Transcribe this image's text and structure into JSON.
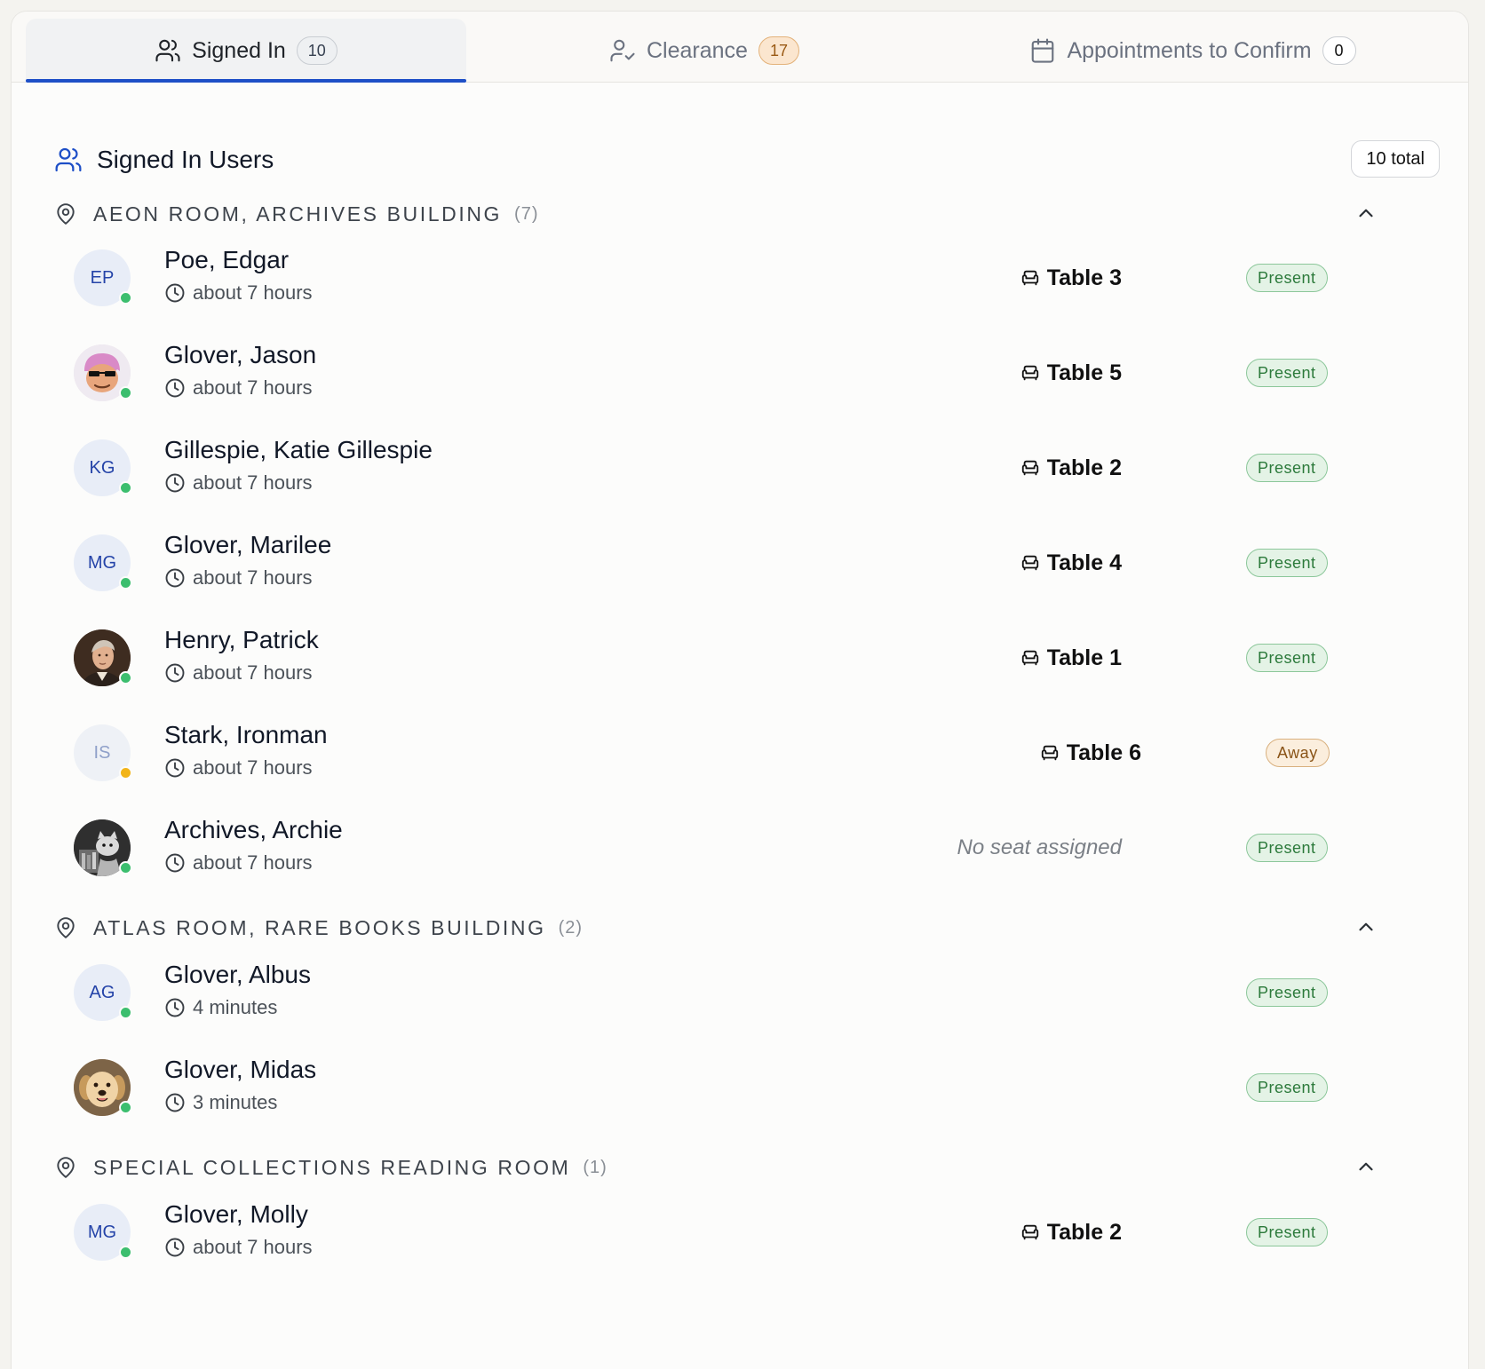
{
  "tabs": [
    {
      "label": "Signed In",
      "count": "10"
    },
    {
      "label": "Clearance",
      "count": "17"
    },
    {
      "label": "Appointments to Confirm",
      "count": "0"
    }
  ],
  "header": {
    "title": "Signed In Users",
    "total": "10 total"
  },
  "groups": [
    {
      "name": "AEON ROOM, ARCHIVES BUILDING",
      "count": "(7)",
      "users": [
        {
          "initials": "EP",
          "name": "Poe, Edgar",
          "since": "about 7 hours",
          "seat": "Table 3",
          "status": "Present"
        },
        {
          "initials": "",
          "name": "Glover, Jason",
          "since": "about 7 hours",
          "seat": "Table 5",
          "status": "Present"
        },
        {
          "initials": "KG",
          "name": "Gillespie, Katie Gillespie",
          "since": "about 7 hours",
          "seat": "Table 2",
          "status": "Present"
        },
        {
          "initials": "MG",
          "name": "Glover, Marilee",
          "since": "about 7 hours",
          "seat": "Table 4",
          "status": "Present"
        },
        {
          "initials": "",
          "name": "Henry, Patrick",
          "since": "about 7 hours",
          "seat": "Table 1",
          "status": "Present"
        },
        {
          "initials": "IS",
          "name": "Stark, Ironman",
          "since": "about 7 hours",
          "seat": "Table 6",
          "status": "Away"
        },
        {
          "initials": "",
          "name": "Archives, Archie",
          "since": "about 7 hours",
          "seat": "No seat assigned",
          "status": "Present"
        }
      ]
    },
    {
      "name": "ATLAS ROOM, RARE BOOKS BUILDING",
      "count": "(2)",
      "users": [
        {
          "initials": "AG",
          "name": "Glover, Albus",
          "since": "4 minutes",
          "seat": "",
          "status": "Present"
        },
        {
          "initials": "",
          "name": "Glover, Midas",
          "since": "3 minutes",
          "seat": "",
          "status": "Present"
        }
      ]
    },
    {
      "name": "SPECIAL COLLECTIONS READING ROOM",
      "count": "(1)",
      "users": [
        {
          "initials": "MG",
          "name": "Glover, Molly",
          "since": "about 7 hours",
          "seat": "Table 2",
          "status": "Present"
        }
      ]
    }
  ],
  "icons": {
    "users": "users-icon",
    "user_check": "user-check-icon",
    "calendar": "calendar-icon",
    "location": "map-pin-icon",
    "clock": "clock-icon",
    "seat": "armchair-icon",
    "collapse": "chevron-up-icon"
  },
  "colors": {
    "accent": "#1e4fc7",
    "present": "#2c7a3b",
    "away": "#8a5417",
    "online_dot": "#3cbe6e",
    "away_dot": "#f2b418"
  }
}
